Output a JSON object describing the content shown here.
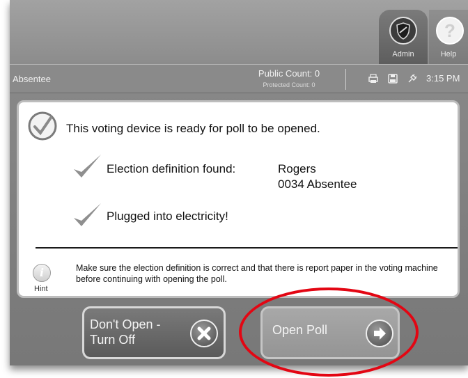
{
  "topbar": {
    "admin_label": "Admin",
    "help_label": "Help",
    "help_glyph": "?"
  },
  "status": {
    "mode": "Absentee",
    "public_count": "Public Count: 0",
    "protected_count": "Protected Count: 0",
    "time": "3:15 PM",
    "icons": [
      "printer-icon",
      "save-disk-icon",
      "power-plug-icon"
    ]
  },
  "panel": {
    "ready_message": "This voting device is ready for poll to be opened.",
    "election_label": "Election definition found:",
    "election_name": "Rogers",
    "election_precinct": "0034 Absentee",
    "power_message": "Plugged into electricity!",
    "hint_label": "Hint",
    "hint_glyph": "i",
    "hint_text": "Make sure the election definition is correct and that there is report paper in the voting machine before continuing with opening the poll."
  },
  "buttons": {
    "dont_open_line1": "Don't Open -",
    "dont_open_line2": "Turn Off",
    "open_poll": "Open Poll"
  },
  "colors": {
    "highlight_ring": "#e30613",
    "panel_background": "#ffffff",
    "screen_gray": "#8a8a8a"
  }
}
